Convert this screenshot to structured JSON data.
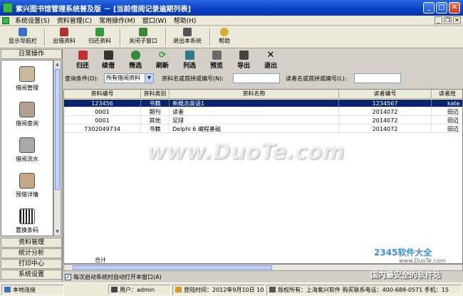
{
  "window": {
    "title": "紫兴图书馆管理系统普及版 － [当前借阅记录逾期列表]"
  },
  "menu": [
    "系统设置(S)",
    "资料管理(C)",
    "常用操作(M)",
    "窗口(W)",
    "帮助(H)"
  ],
  "toolbar": [
    "显示导航栏",
    "出借资料",
    "归还资料",
    "关闭子窗口",
    "退出本系统",
    "帮助"
  ],
  "sidebar": {
    "head": "日常操作",
    "items": [
      "借阅管理",
      "借阅查询",
      "借阅流水",
      "预借详情",
      "置换条码"
    ],
    "categories": [
      "资料管理",
      "统计分析",
      "打印中心",
      "系统设置"
    ]
  },
  "maintoolbar": [
    "归还",
    "续借",
    "筛选",
    "刷新",
    "列选",
    "预览",
    "导出",
    "退出"
  ],
  "filter": {
    "cond_label": "查询条件(D):",
    "cond_value": "所有借阅资料",
    "name_label": "资料名或首拼或编号(N):",
    "reader_label": "读者名或首拼或编号(L):"
  },
  "table": {
    "columns": [
      "资料编号",
      "资料类别",
      "资料名称",
      "读者编号",
      "读者姓"
    ],
    "rows": [
      [
        "123456",
        "书籍",
        "新概念英语1",
        "1234567",
        "kate"
      ],
      [
        "0001",
        "期刊",
        "读者",
        "2014072",
        "田迈"
      ],
      [
        "0001",
        "其他",
        "足球",
        "2014072",
        "田迈"
      ],
      [
        "7302049734",
        "书籍",
        "Delphi 6 编程基础",
        "2014072",
        "田迈"
      ]
    ],
    "selected_row": 0,
    "sum_label": "合计"
  },
  "checkbox": {
    "label": "每次启动系统时自动打开本窗口(A)",
    "checked": true
  },
  "status": [
    "本地连接",
    "用户：admin",
    "登陆时间：2012年9月10日 10:14",
    "版权所有：上海紫兴软件  购买联系电话：400-688-0571  手机：15"
  ],
  "watermark": {
    "text": "www.DuoTe.com",
    "logo": "2345软件大全",
    "logo_url": "www.DuoTe.com",
    "slogan": "国内最安全的软件站"
  },
  "colors": {
    "titlebar": "#0a3fc4",
    "selection": "#0a246a",
    "panel": "#d4d0c8"
  }
}
